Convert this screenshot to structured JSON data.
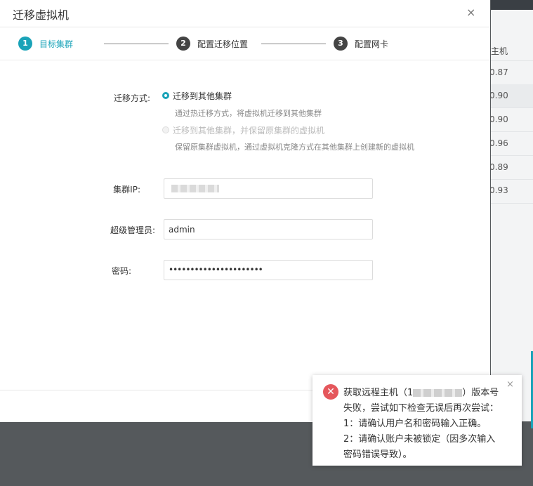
{
  "background": {
    "column_header": "主机",
    "values": [
      "0.87",
      "0.90",
      "0.90",
      "0.96",
      "0.89",
      "0.93"
    ]
  },
  "modal": {
    "title": "迁移虚拟机",
    "close_glyph": "×",
    "steps": [
      {
        "number": "1",
        "label": "目标集群",
        "state": "active"
      },
      {
        "number": "2",
        "label": "配置迁移位置",
        "state": "pending"
      },
      {
        "number": "3",
        "label": "配置网卡",
        "state": "pending"
      }
    ],
    "colors": {
      "accent": "#1aa3b8",
      "step_pending": "#444444",
      "error": "#e5575c"
    },
    "form": {
      "method_label": "迁移方式:",
      "options": [
        {
          "label": "迁移到其他集群",
          "hint": "通过热迁移方式，将虚拟机迁移到其他集群",
          "selected": true
        },
        {
          "label": "迁移到其他集群，并保留原集群的虚拟机",
          "hint": "保留原集群虚拟机，通过虚拟机克隆方式在其他集群上创建新的虚拟机",
          "selected": false
        }
      ],
      "ip_label": "集群IP:",
      "admin_label": "超级管理员:",
      "admin_value": "admin",
      "password_label": "密码:",
      "password_value": "••••••••••••••••••••••"
    }
  },
  "toast": {
    "icon": "error-icon",
    "close_glyph": "×",
    "line1_prefix": "获取远程主机（1",
    "line1_suffix": "）版本号",
    "line2": "失败，尝试如下检查无误后再次尝试：",
    "line3": "1：请确认用户名和密码输入正确。",
    "line4": "2：请确认账户未被锁定（因多次输入",
    "line5": "密码错误导致）。"
  }
}
